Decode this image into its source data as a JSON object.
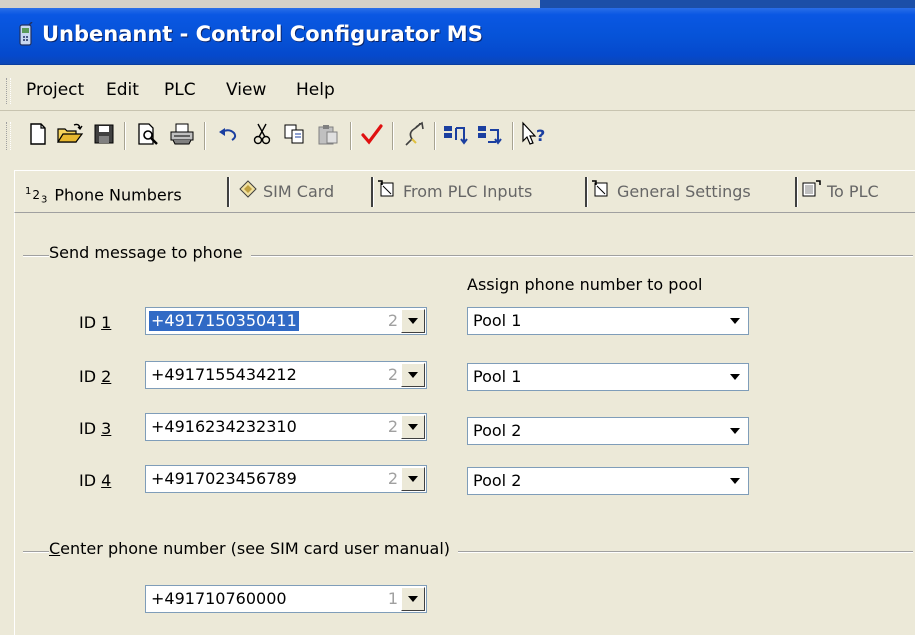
{
  "window": {
    "title": "Unbenannt - Control Configurator MS"
  },
  "menu": [
    "Project",
    "Edit",
    "PLC",
    "View",
    "Help"
  ],
  "toolbar": {
    "icons": [
      "new-document-icon",
      "open-folder-icon",
      "save-icon",
      "print-preview-icon",
      "print-icon",
      "undo-icon",
      "cut-icon",
      "copy-icon",
      "paste-icon",
      "check-icon",
      "connect-icon",
      "upload-icon",
      "download-icon",
      "help-pointer-icon"
    ]
  },
  "tabs": [
    {
      "label": "Phone Numbers",
      "prefix": "1",
      "prefix2": "2",
      "prefix3": "3",
      "active": true
    },
    {
      "label": "SIM Card"
    },
    {
      "label": "From PLC Inputs"
    },
    {
      "label": "General Settings"
    },
    {
      "label": "To PLC"
    }
  ],
  "send_group": {
    "title": "Send message to phone",
    "pool_header": "Assign phone number to pool",
    "rows": [
      {
        "id_prefix": "ID ",
        "id_num": "1",
        "phone": "+4917150350411",
        "count": "2",
        "pool": "Pool 1",
        "selected": true
      },
      {
        "id_prefix": "ID ",
        "id_num": "2",
        "phone": "+4917155434212",
        "count": "2",
        "pool": "Pool 1"
      },
      {
        "id_prefix": "ID ",
        "id_num": "3",
        "phone": "+4916234232310",
        "count": "2",
        "pool": "Pool 2"
      },
      {
        "id_prefix": "ID ",
        "id_num": "4",
        "phone": "+4917023456789",
        "count": "2",
        "pool": "Pool 2"
      }
    ]
  },
  "center_group": {
    "title_first": "C",
    "title_rest": "enter phone number (see SIM card user manual)",
    "phone": "+491710760000",
    "count": "1"
  },
  "colors": {
    "titlebar": "#0653d8",
    "selection": "#316ac5",
    "window_bg": "#ece9d8"
  }
}
